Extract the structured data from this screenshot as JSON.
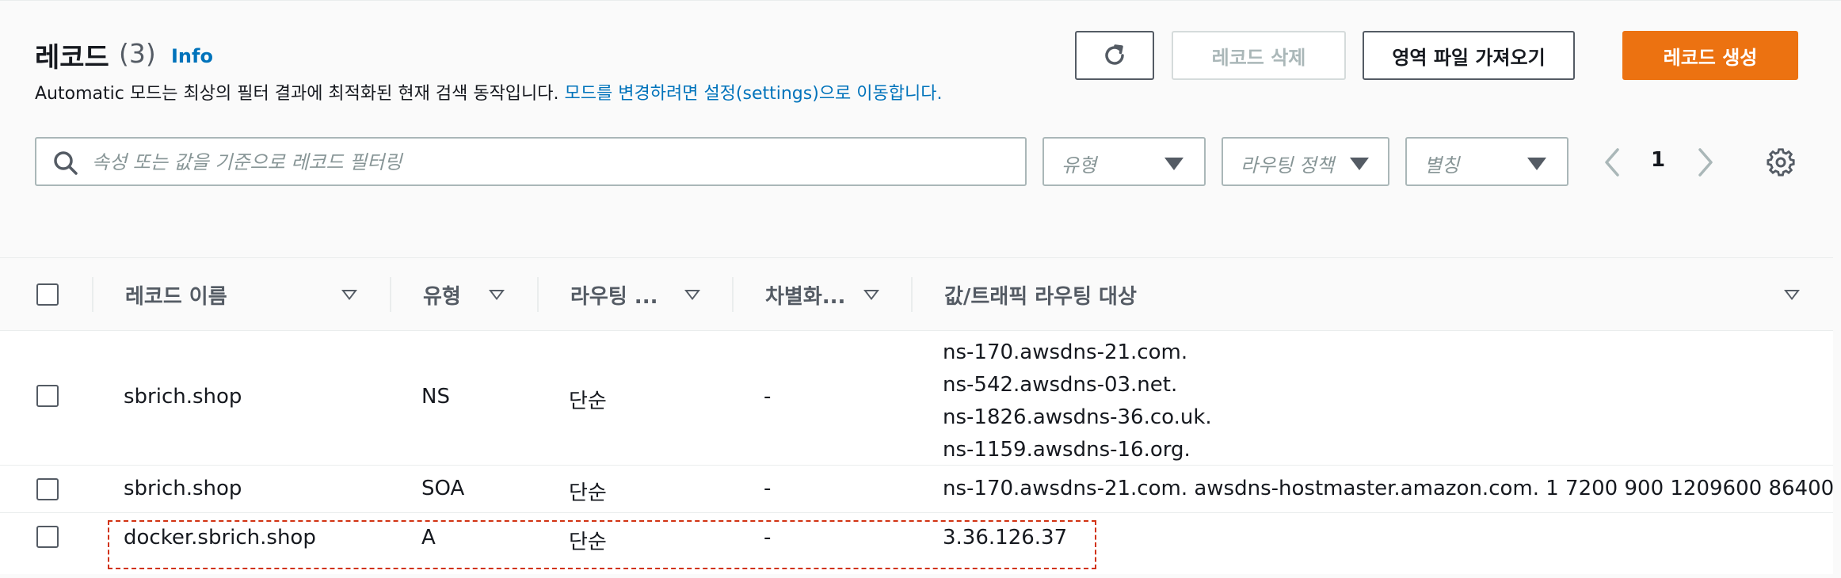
{
  "header": {
    "title": "레코드",
    "count": "(3)",
    "info_link": "Info",
    "description": "Automatic 모드는 최상의 필터 결과에 최적화된 현재 검색 동작입니다.",
    "settings_link": "모드를 변경하려면 설정(settings)으로 이동합니다."
  },
  "toolbar": {
    "delete_label": "레코드 삭제",
    "import_label": "영역 파일 가져오기",
    "create_label": "레코드 생성"
  },
  "filters": {
    "search_placeholder": "속성 또는 값을 기준으로 레코드 필터링",
    "type_select": "유형",
    "routing_select": "라우팅 정책",
    "alias_select": "별칭"
  },
  "pagination": {
    "current_page": "1"
  },
  "table": {
    "columns": [
      "레코드 이름",
      "유형",
      "라우팅 ...",
      "차별화...",
      "값/트래픽 라우팅 대상"
    ],
    "rows": [
      {
        "name": "sbrich.shop",
        "type": "NS",
        "routing": "단순",
        "differentiator": "-",
        "values": [
          "ns-170.awsdns-21.com.",
          "ns-542.awsdns-03.net.",
          "ns-1826.awsdns-36.co.uk.",
          "ns-1159.awsdns-16.org."
        ]
      },
      {
        "name": "sbrich.shop",
        "type": "SOA",
        "routing": "단순",
        "differentiator": "-",
        "values": [
          "ns-170.awsdns-21.com. awsdns-hostmaster.amazon.com. 1 7200 900 1209600 86400"
        ]
      },
      {
        "name": "docker.sbrich.shop",
        "type": "A",
        "routing": "단순",
        "differentiator": "-",
        "values": [
          "3.36.126.37"
        ]
      }
    ]
  },
  "colors": {
    "accent": "#ec7211",
    "link": "#0073bb",
    "highlight": "#d13212"
  }
}
